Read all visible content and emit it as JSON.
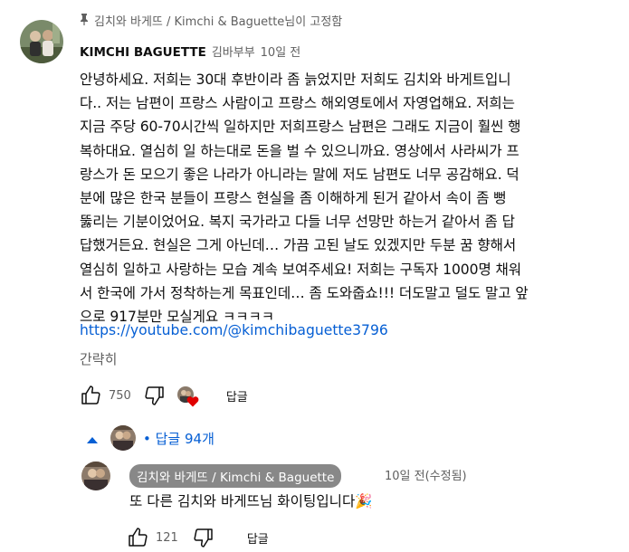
{
  "pinned": {
    "pin_icon": "pin-icon",
    "text": "김치와 바게뜨 / Kimchi & Baguette님이 고정함"
  },
  "comment": {
    "author": "KIMCHI BAGUETTE",
    "handle": "김바부부",
    "time": "10일 전",
    "lines": [
      "안녕하세요. 저희는 30대 후반이라 좀 늙었지만 저희도 김치와 바게트입니",
      "다.. 저는 남편이 프랑스 사람이고 프랑스 해외영토에서 자영업해요. 저희는",
      "지금 주당 60-70시간씩 일하지만 저희프랑스 남편은 그래도 지금이 훨씬 행",
      "복하대요. 열심히 일 하는대로 돈을 벌 수 있으니까요. 영상에서 사라씨가 프",
      "랑스가 돈 모으기 좋은 나라가 아니라는 말에 저도 남편도 너무 공감해요. 덕",
      "분에 많은 한국 분들이 프랑스 현실을 좀 이해하게 된거 같아서 속이 좀 뻥",
      "뚫리는 기분이었어요. 복지 국가라고 다들 너무 선망만 하는거 같아서 좀 답",
      "답했거든요. 현실은 그게 아닌데… 가끔 고된 날도 있겠지만 두분 꿈 향해서",
      "열심히 일하고 사랑하는 모습 계속 보여주세요! 저희는 구독자 1000명 채워",
      "서 한국에 가서 정착하는게 목표인데… 좀 도와줍쇼!!! 더도말고 덜도 말고 앞",
      "으로 917분만 모실게요 ㅋㅋㅋㅋ"
    ],
    "link": "https://youtube.com/@kimchibaguette3796",
    "read_less": "간략히",
    "likes": "750",
    "reply_label": "답글"
  },
  "replies_toggle": {
    "label": "답글 94개"
  },
  "reply": {
    "author": "김치와 바게뜨 / Kimchi & Baguette",
    "time": "10일 전(수정됨)",
    "text": "또 다른 김치와 바게뜨님 화이팅입니다",
    "emoji": "🎉",
    "likes": "121",
    "reply_label": "답글"
  },
  "colors": {
    "link": "#065fd4",
    "secondary_text": "#606060",
    "chip_bg": "#888888",
    "heart": "#e00000"
  }
}
